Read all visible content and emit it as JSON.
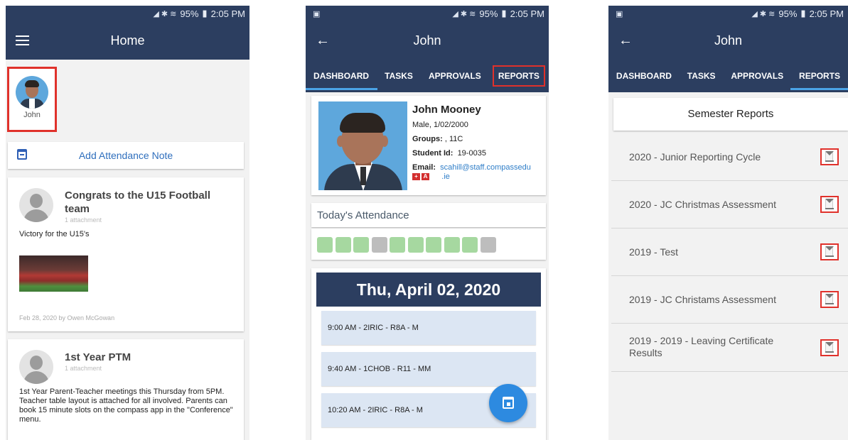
{
  "status": {
    "time": "2:05 PM",
    "battery": "95%"
  },
  "screen1": {
    "title": "Home",
    "avatar_name": "John",
    "add_attendance_note": "Add Attendance Note",
    "posts": [
      {
        "title": "Congrats to the U15 Football team",
        "attachments": "1 attachment",
        "body": "Victory for the U15's",
        "footer": "Feb 28, 2020 by Owen McGowan"
      },
      {
        "title": "1st Year PTM",
        "attachments": "1 attachment",
        "body": "1st Year Parent-Teacher meetings this Thursday from 5PM. Teacher table layout is attached for all involved. Parents can book 15 minute slots on the compass app in the \"Conference\" menu."
      }
    ]
  },
  "screen2": {
    "title": "John",
    "tabs": [
      "DASHBOARD",
      "TASKS",
      "APPROVALS",
      "REPORTS"
    ],
    "active_tab": "DASHBOARD",
    "student": {
      "name": "John Mooney",
      "gender_dob": "Male, 1/02/2000",
      "groups_label": "Groups:",
      "groups_value": ", 11C",
      "id_label": "Student Id:",
      "id_value": "19-0035",
      "email_label": "Email:",
      "email_value_line1": "scahill@staff.compassedu",
      "email_value_line2": ".ie",
      "flag_labels": [
        "+",
        "A"
      ]
    },
    "todays_attendance": "Today's Attendance",
    "attendance_squares": [
      "present",
      "present",
      "present",
      "absent",
      "present",
      "present",
      "present",
      "present",
      "present",
      "absent"
    ],
    "attendance_colors": {
      "present": "#a6d8a0",
      "absent": "#bdbdbd"
    },
    "date_header": "Thu, April 02, 2020",
    "schedule": [
      "9:00 AM - 2IRIC - R8A - M",
      "9:40 AM - 1CHOB - R11 - MM",
      "10:20 AM - 2IRIC - R8A - M"
    ]
  },
  "screen3": {
    "title": "John",
    "tabs": [
      "DASHBOARD",
      "TASKS",
      "APPROVALS",
      "REPORTS"
    ],
    "active_tab": "REPORTS",
    "header": "Semester Reports",
    "reports": [
      "2020 - Junior Reporting Cycle",
      "2020 - JC Christmas Assessment",
      "2019 - Test",
      "2019 - JC Christams Assessment",
      "2019 - 2019 - Leaving Certificate Results"
    ]
  },
  "colors": {
    "appbar": "#2c3e60",
    "tab_indicator": "#4aa3e6",
    "highlight_box": "#e0312b",
    "fab": "#2d8ae0"
  }
}
